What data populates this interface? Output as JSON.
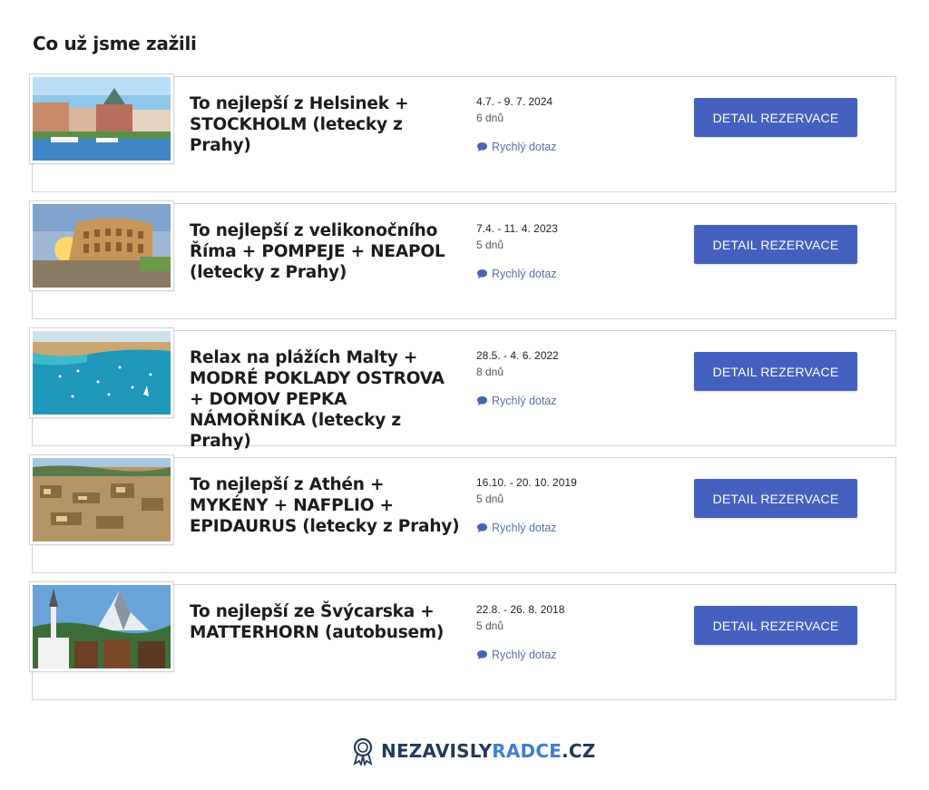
{
  "section": {
    "title": "Co už jsme zažili"
  },
  "trips": [
    {
      "title": "To nejlepší z Helsinek + STOCKHOLM (letecky z Prahy)",
      "dates": "4.7. - 9. 7. 2024",
      "duration": "6 dnů",
      "quick_label": "Rychlý dotaz",
      "button_label": "DETAIL REZERVACE"
    },
    {
      "title": "To nejlepší z velikonočního Říma + POMPEJE + NEAPOL (letecky z Prahy)",
      "dates": "7.4. - 11. 4. 2023",
      "duration": "5 dnů",
      "quick_label": "Rychlý dotaz",
      "button_label": "DETAIL REZERVACE"
    },
    {
      "title": "Relax na plážích Malty + MODRÉ POKLADY OSTROVA + DOMOV PEPKA NÁMOŘNÍKA (letecky z Prahy)",
      "dates": "28.5. - 4. 6. 2022",
      "duration": "8 dnů",
      "quick_label": "Rychlý dotaz",
      "button_label": "DETAIL REZERVACE"
    },
    {
      "title": "To nejlepší z Athén + MYKÉNY + NAFPLIO + EPIDAURUS (letecky z Prahy)",
      "dates": "16.10. - 20. 10. 2019",
      "duration": "5 dnů",
      "quick_label": "Rychlý dotaz",
      "button_label": "DETAIL REZERVACE"
    },
    {
      "title": "To nejlepší ze Švýcarska + MATTERHORN (autobusem)",
      "dates": "22.8. - 26. 8. 2018",
      "duration": "5 dnů",
      "quick_label": "Rychlý dotaz",
      "button_label": "DETAIL REZERVACE"
    }
  ],
  "logo": {
    "part1": "NEZAVISLY",
    "part2": "RADCE",
    "part3": ".CZ"
  },
  "colors": {
    "button": "#4461c0",
    "link": "#5a6fa8",
    "logo_dark": "#1f3a5c",
    "logo_accent": "#3d7fd0"
  }
}
